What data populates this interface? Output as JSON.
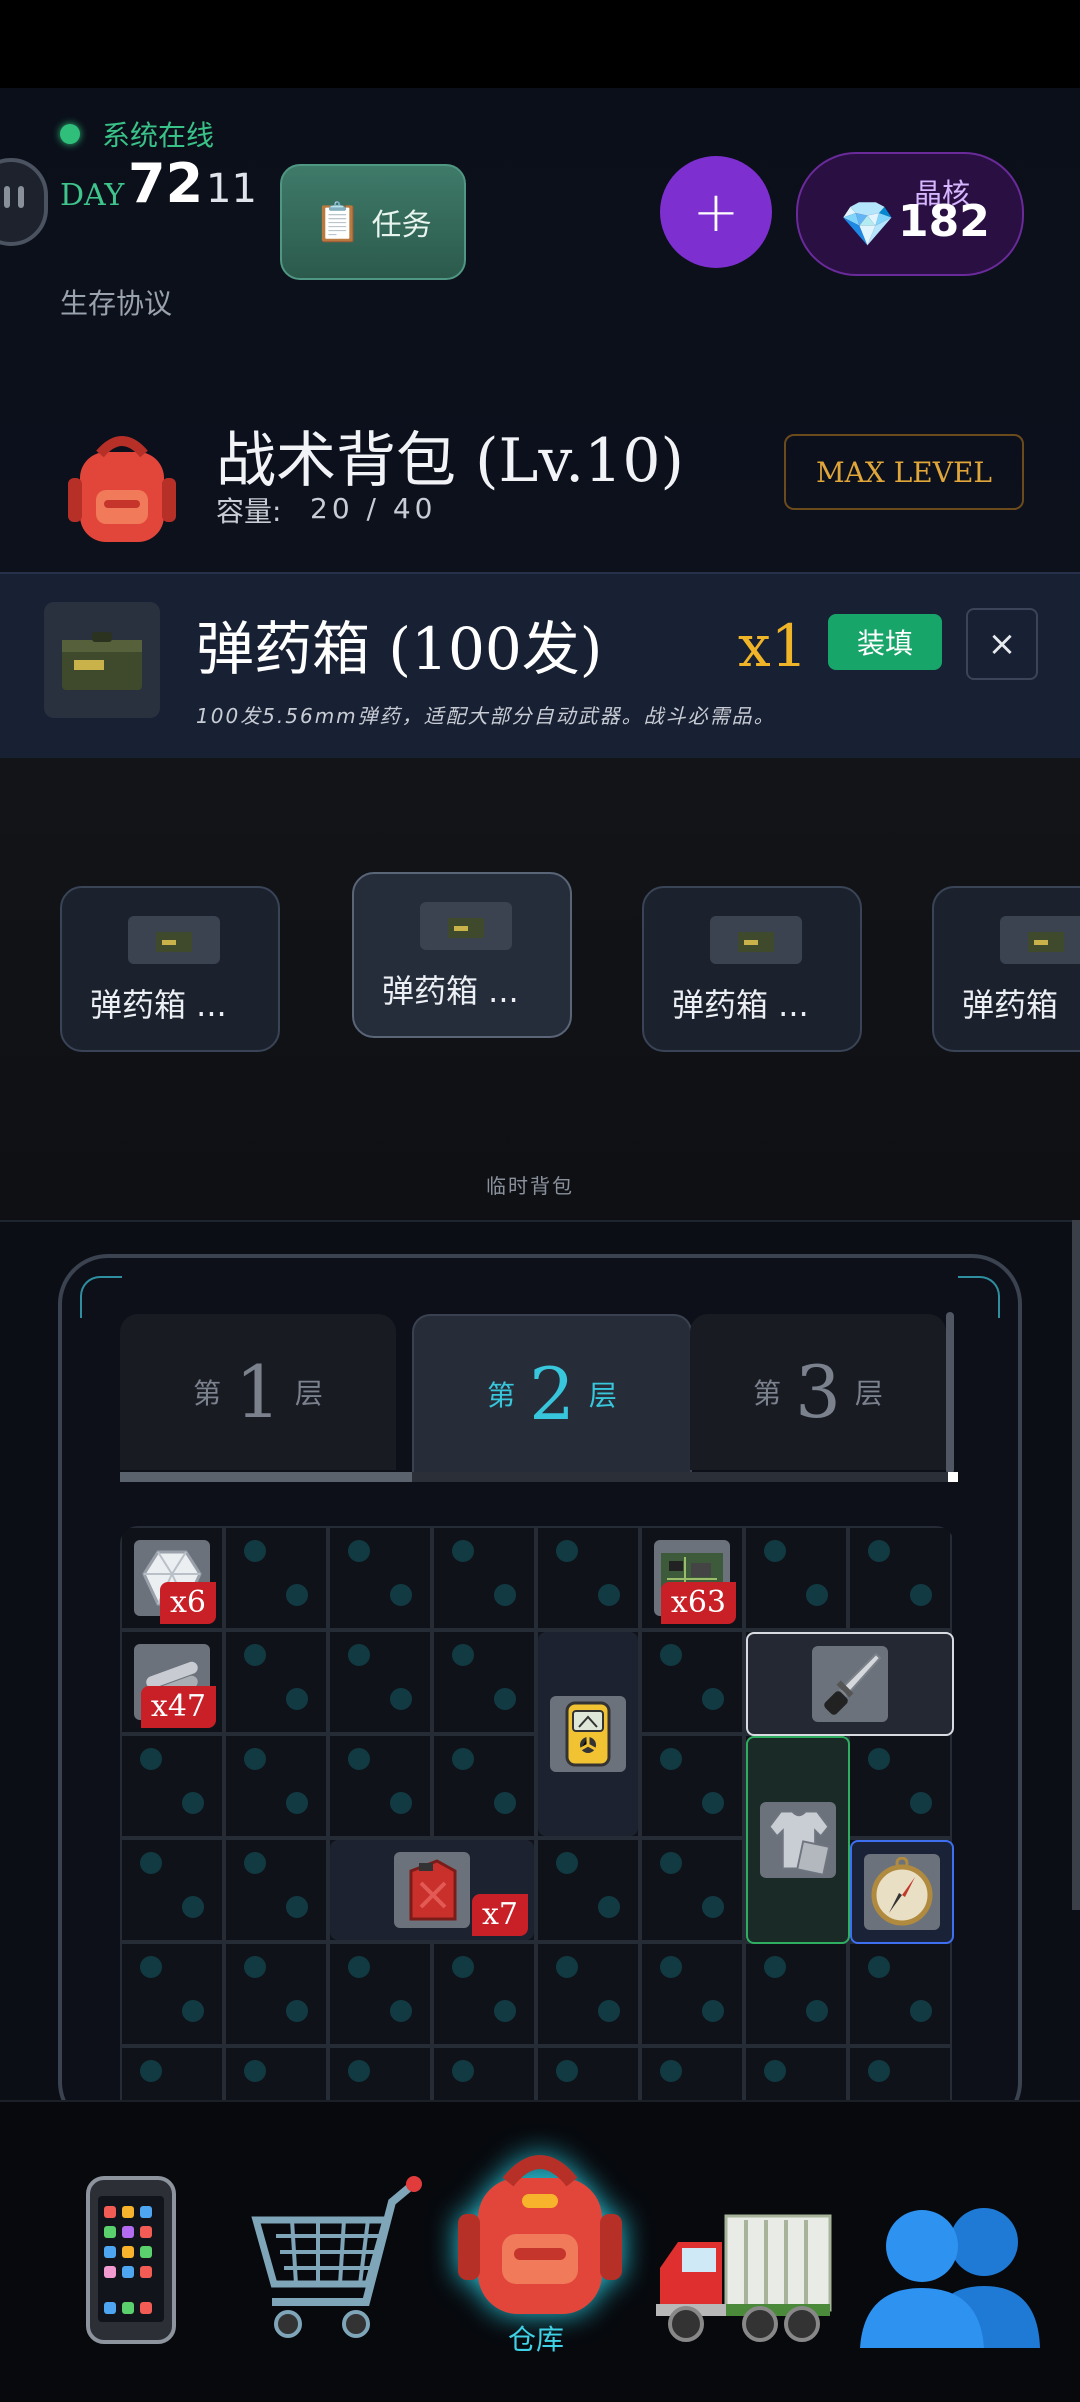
{
  "status": {
    "text": "系统在线",
    "color": "#2fbf7a"
  },
  "day": {
    "label": "DAY",
    "number": "72",
    "time": "11"
  },
  "task_button": {
    "label": "任务",
    "icon": "clipboard-icon"
  },
  "subtitle": "生存协议",
  "currency": {
    "label": "晶核",
    "value": "182",
    "icon": "gem-icon"
  },
  "plus_button": {
    "label": "+"
  },
  "backpack": {
    "title": "战术背包 (Lv.10)",
    "capacity_label": "容量:",
    "capacity_value": "20 / 40",
    "max_label": "MAX LEVEL",
    "icon": "backpack-icon"
  },
  "selected_item": {
    "title": "弹药箱 (100发)",
    "quantity": "x1",
    "load_label": "装填",
    "close_label": "×",
    "description": "100发5.56mm弹药，适配大部分自动武器。战斗必需品。",
    "icon": "ammo-box-icon"
  },
  "carousel": {
    "cards": [
      {
        "label": "弹药箱 ...",
        "icon": "ammo-box-icon"
      },
      {
        "label": "弹药箱 ...",
        "icon": "ammo-box-icon"
      },
      {
        "label": "弹药箱 ...",
        "icon": "ammo-box-icon"
      },
      {
        "label": "弹药箱",
        "icon": "ammo-box-icon"
      }
    ],
    "caption": "临时背包"
  },
  "storage": {
    "tabs": [
      {
        "pre": "第",
        "num": "1",
        "post": "层"
      },
      {
        "pre": "第",
        "num": "2",
        "post": "层"
      },
      {
        "pre": "第",
        "num": "3",
        "post": "层"
      }
    ],
    "active_tab": "2",
    "items": [
      {
        "name": "gem-ore",
        "icon": "gem-ore-icon",
        "count": "x6"
      },
      {
        "name": "circuit-board",
        "icon": "circuit-board-icon",
        "count": "x63"
      },
      {
        "name": "metal-pipes",
        "icon": "metal-pipes-icon",
        "count": "x47"
      },
      {
        "name": "combat-knife",
        "icon": "knife-icon",
        "count": ""
      },
      {
        "name": "geiger-counter",
        "icon": "geiger-counter-icon",
        "count": ""
      },
      {
        "name": "shirt",
        "icon": "shirt-icon",
        "count": ""
      },
      {
        "name": "fuel-can",
        "icon": "fuel-can-icon",
        "count": "x7"
      },
      {
        "name": "compass",
        "icon": "compass-icon",
        "count": ""
      }
    ]
  },
  "nav": {
    "items": [
      {
        "icon": "phone-icon",
        "label": ""
      },
      {
        "icon": "cart-icon",
        "label": ""
      },
      {
        "icon": "backpack-icon",
        "label": "仓库"
      },
      {
        "icon": "truck-icon",
        "label": ""
      },
      {
        "icon": "people-icon",
        "label": ""
      }
    ]
  }
}
